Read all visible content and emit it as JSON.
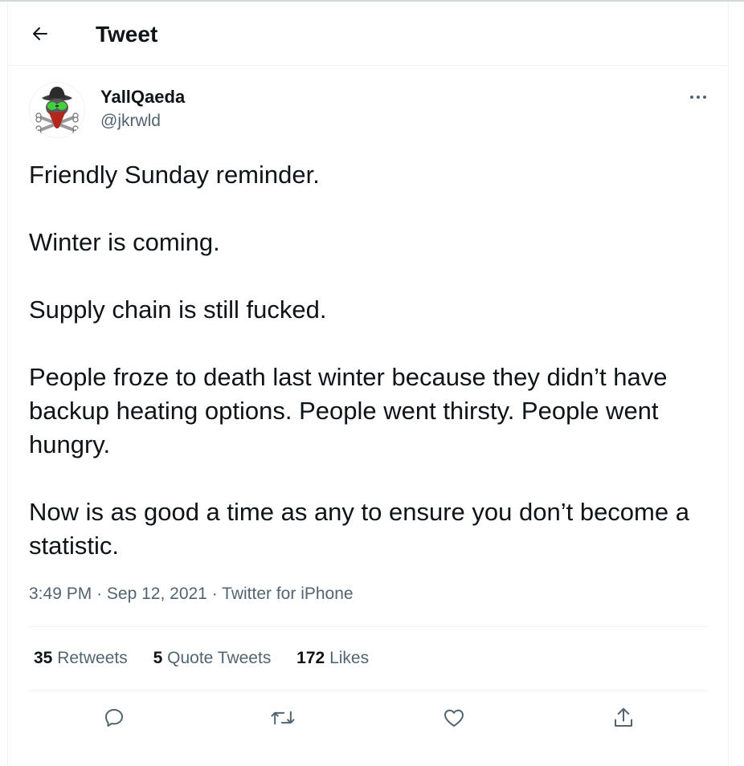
{
  "header": {
    "title": "Tweet",
    "back_icon": "arrow-left-icon"
  },
  "author": {
    "display_name": "YallQaeda",
    "handle": "@jkrwld",
    "avatar_icon": "skull-crossbones-avatar"
  },
  "tweet": {
    "paragraphs": [
      "Friendly Sunday reminder.",
      "Winter is coming.",
      "Supply chain is still fucked.",
      "People froze to death last winter because they didn’t have backup heating options. People went thirsty. People went hungry.",
      "Now is as good a time as any to ensure you don’t become a statistic."
    ],
    "time": "3:49 PM",
    "separator": "·",
    "date": "Sep 12, 2021",
    "source": "Twitter for iPhone"
  },
  "stats": {
    "retweets_count": "35",
    "retweets_label": "Retweets",
    "quote_tweets_count": "5",
    "quote_tweets_label": "Quote Tweets",
    "likes_count": "172",
    "likes_label": "Likes"
  },
  "actions": {
    "reply_icon": "reply-icon",
    "retweet_icon": "retweet-icon",
    "like_icon": "like-icon",
    "share_icon": "share-icon"
  },
  "colors": {
    "text_primary": "#0f1419",
    "text_secondary": "#536471",
    "divider": "#eff3f4",
    "background": "#ffffff"
  }
}
